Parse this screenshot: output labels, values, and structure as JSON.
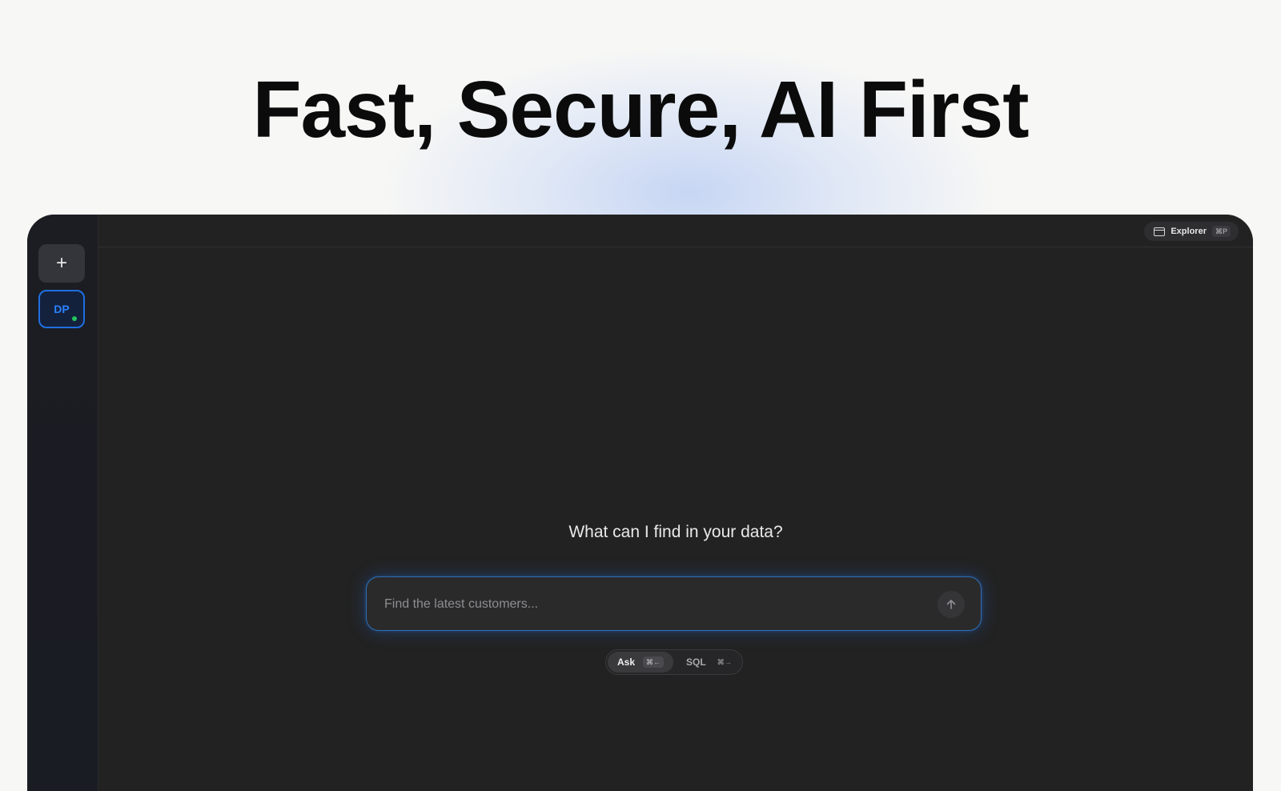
{
  "hero": {
    "title": "Fast, Secure, AI First"
  },
  "sidebar": {
    "new_button_label": "+",
    "connections": [
      {
        "initials": "DP",
        "status": "connected",
        "status_color": "#22c55e"
      }
    ]
  },
  "topbar": {
    "explorer_label": "Explorer",
    "explorer_shortcut": "⌘P"
  },
  "main": {
    "heading": "What can I find in your data?",
    "search": {
      "placeholder": "Find the latest customers...",
      "value": ""
    },
    "modes": [
      {
        "label": "Ask",
        "shortcut": "⌘←",
        "active": true
      },
      {
        "label": "SQL",
        "shortcut": "⌘→",
        "active": false
      }
    ]
  },
  "colors": {
    "accent": "#1f6fe0",
    "page_background": "#f7f7f5",
    "panel_background": "#222222"
  },
  "icons": {
    "new": "plus-icon",
    "explorer": "window-icon",
    "send": "arrow-up-icon"
  }
}
